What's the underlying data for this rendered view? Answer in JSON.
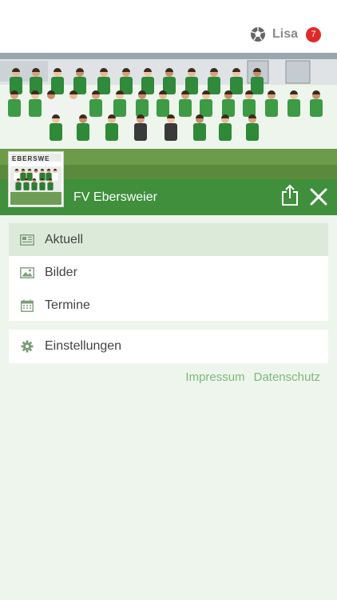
{
  "header": {
    "user_name": "Lisa",
    "notification_count": "7",
    "icons": {
      "user": "soccer-ball-icon"
    }
  },
  "hero": {
    "image": "team-photo",
    "thumbnail_text": "EBERSWE"
  },
  "club": {
    "name": "FV Ebersweier",
    "icons": {
      "share": "share-icon",
      "close": "close-icon"
    }
  },
  "menu": {
    "items": [
      {
        "label": "Aktuell",
        "icon": "newspaper-icon",
        "active": true
      },
      {
        "label": "Bilder",
        "icon": "image-icon",
        "active": false
      },
      {
        "label": "Termine",
        "icon": "calendar-icon",
        "active": false
      }
    ],
    "settings": {
      "label": "Einstellungen",
      "icon": "gear-icon"
    }
  },
  "footer": {
    "impressum": "Impressum",
    "datenschutz": "Datenschutz"
  },
  "colors": {
    "accent": "#3f8f3c",
    "active_row": "#dcebd9",
    "background": "#eef5ec",
    "badge": "#e02a2a",
    "link": "#7cb87a"
  }
}
